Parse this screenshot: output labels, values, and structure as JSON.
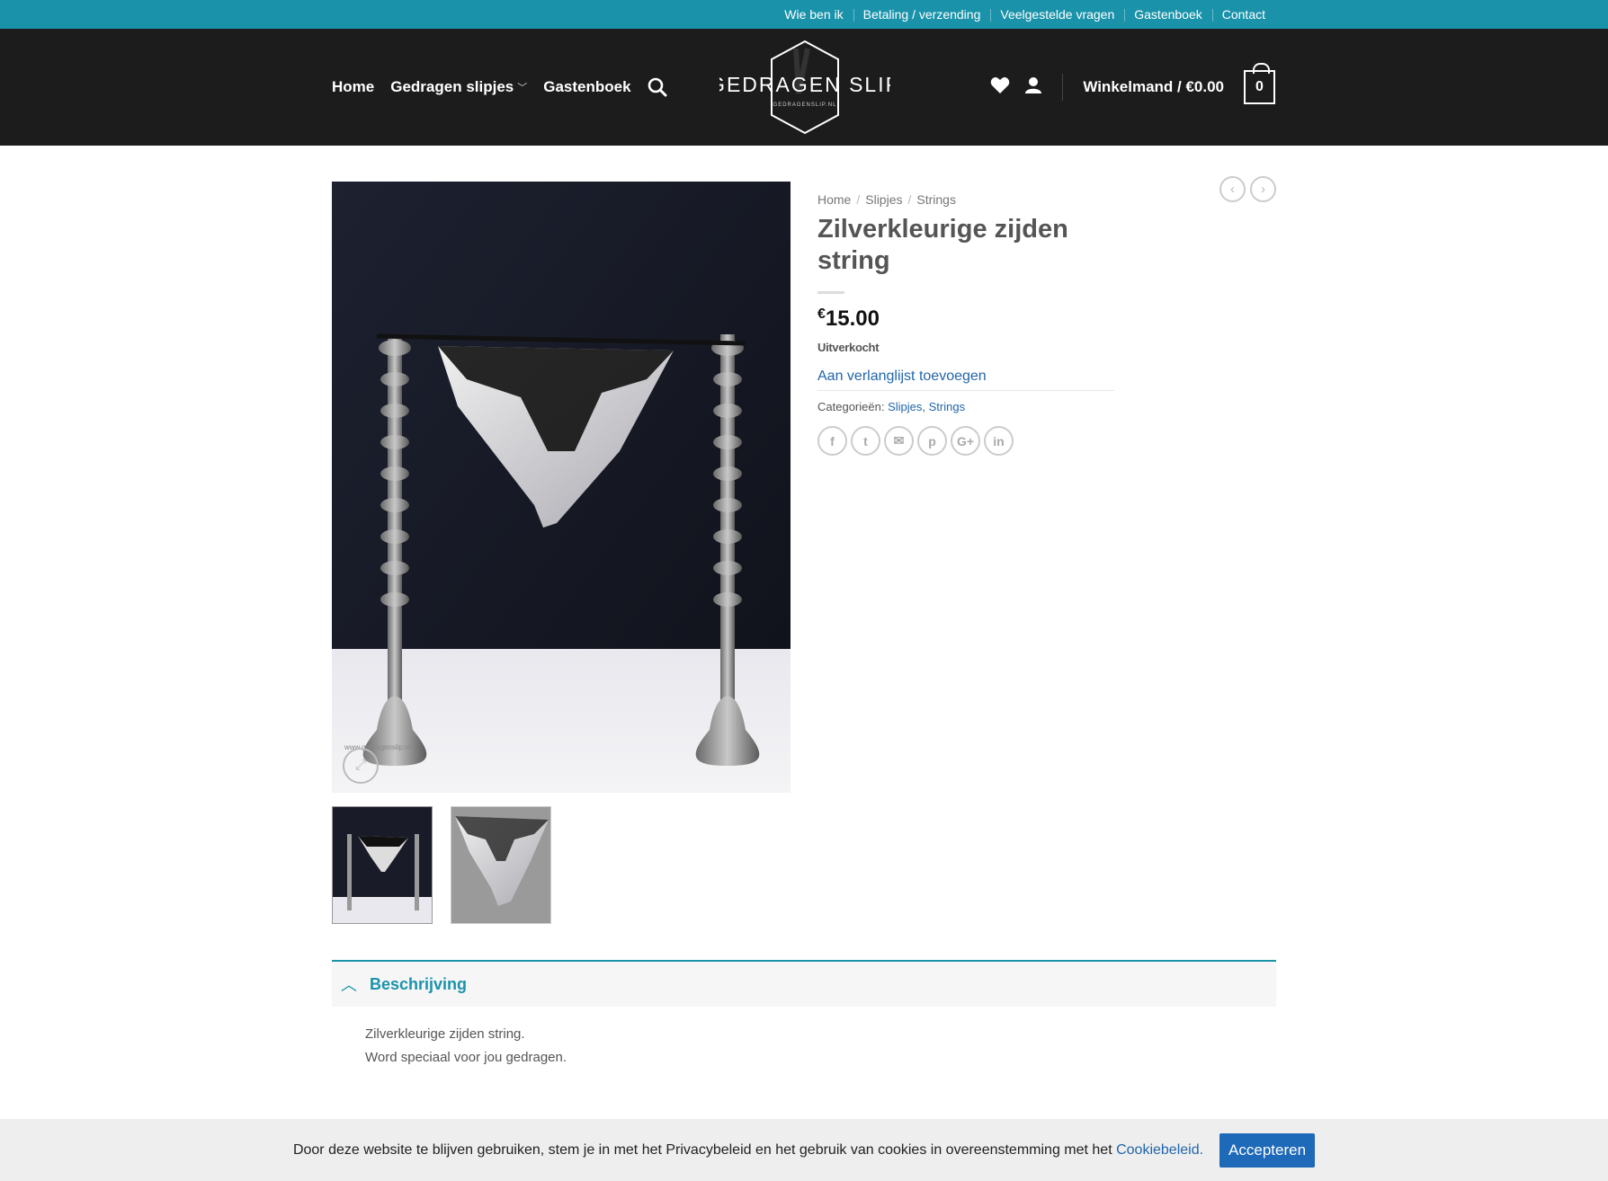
{
  "topbar": {
    "links": [
      "Wie ben ik",
      "Betaling / verzending",
      "Veelgestelde vragen",
      "Gastenboek",
      "Contact"
    ]
  },
  "header": {
    "nav": {
      "home": "Home",
      "worn": "Gedragen slipjes",
      "guestbook": "Gastenboek"
    },
    "logo": {
      "text": "GEDRAGEN SLIP",
      "subtext": "GEDRAGENSLIP.NL"
    },
    "icons": [
      "search-icon",
      "heart-icon",
      "user-icon"
    ],
    "cart_label": "Winkelmand / €0.00",
    "cart_count": "0"
  },
  "breadcrumb": {
    "home": "Home",
    "cat": "Slipjes",
    "sub": "Strings"
  },
  "product": {
    "title": "Zilverkleurige zijden string",
    "currency": "€",
    "price": "15.00",
    "stock": "Uitverkocht",
    "wishlist": "Aan verlanglijst toevoegen",
    "categories_label": "Categorieën:",
    "categories": [
      "Slipjes",
      "Strings"
    ],
    "share_icons": [
      "facebook-icon",
      "twitter-icon",
      "email-icon",
      "pinterest-icon",
      "google-plus-icon",
      "linkedin-icon"
    ]
  },
  "tab": {
    "label": "Beschrijving"
  },
  "description": [
    "Zilverkleurige zijden string.",
    "Word speciaal voor jou gedragen."
  ],
  "cookie": {
    "text": "Door deze website te blijven gebruiken, stem je in met het Privacybeleid en het gebruik van cookies in overeenstemming met het",
    "link": "Cookiebeleid.",
    "button": "Accepteren"
  },
  "colors": {
    "topbar": "#1a93aa",
    "header": "#1c1c1c",
    "link": "#2266aa",
    "button": "#1e69b8"
  }
}
